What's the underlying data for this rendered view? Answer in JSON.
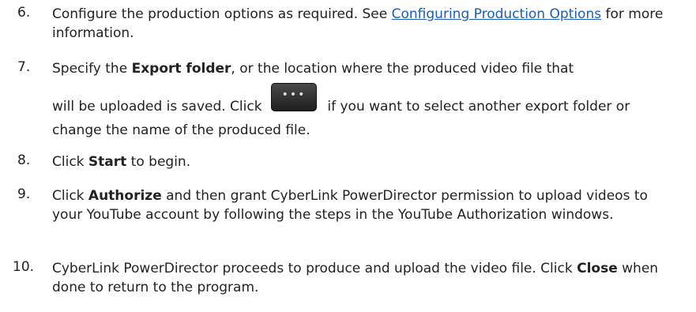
{
  "steps": [
    {
      "number": "6.",
      "pre": "Configure the production options as required. See ",
      "link": "Configuring Production Options",
      "post": " for more information."
    },
    {
      "number": "7.",
      "pre": "Specify the ",
      "bold": "Export folder",
      "mid": ", or the location where the produced video file that",
      "line2_pre": "will be uploaded is saved. Click ",
      "button_glyph": "•••",
      "line2_post": " if you want to select another export folder or change the name of the produced file."
    },
    {
      "number": "8.",
      "pre": "Click ",
      "bold": "Start",
      "post": " to begin."
    },
    {
      "number": "9.",
      "pre": "Click ",
      "bold": "Authorize",
      "post": " and then grant CyberLink PowerDirector permission to upload videos to your YouTube account by following the steps in the YouTube Authorization windows."
    },
    {
      "number": "10.",
      "pre": "CyberLink PowerDirector proceeds to produce and upload the video file. Click ",
      "bold": "Close",
      "post": " when done to return to the program."
    }
  ]
}
